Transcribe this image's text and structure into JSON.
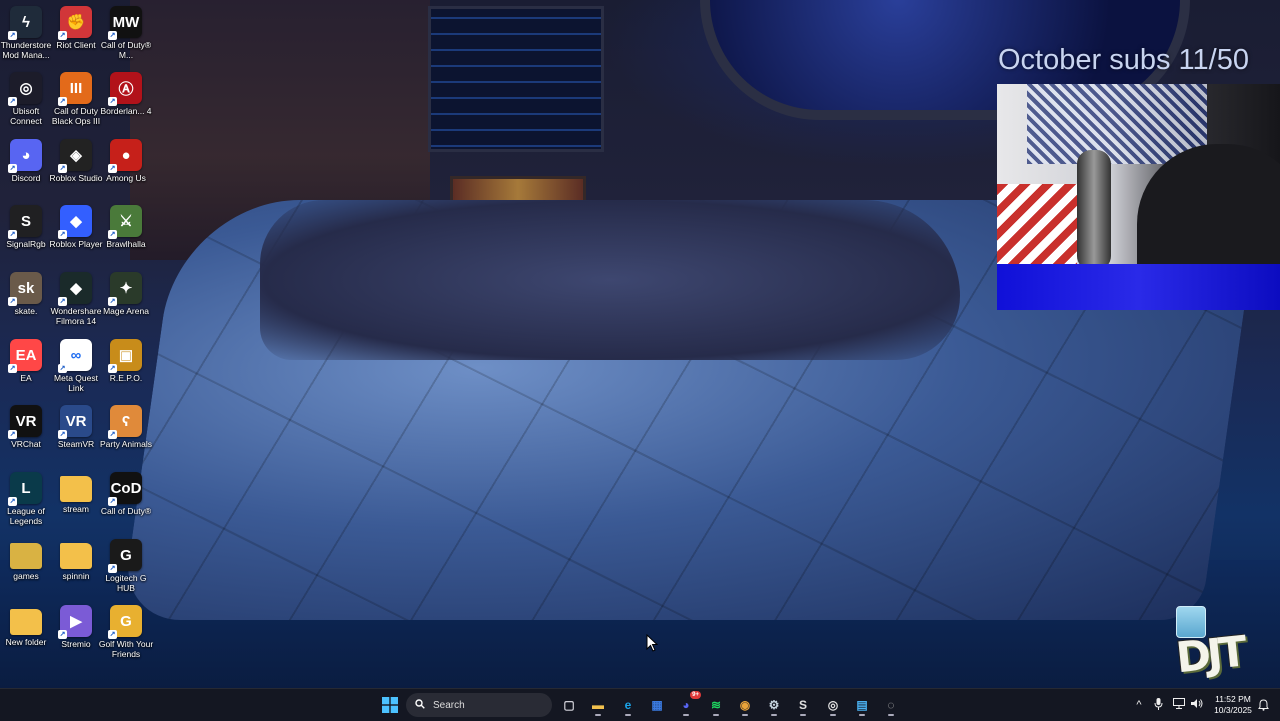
{
  "overlay": {
    "subs_text": "October subs 11/50",
    "corner_logo": "DJT"
  },
  "desktop_icons": [
    {
      "label": "Thunderstore Mod Mana...",
      "icon": "thunderstore-icon",
      "color": "#1f2b3a",
      "glyph": "ϟ"
    },
    {
      "label": "Riot Client",
      "icon": "riot-client-icon",
      "color": "#d13639",
      "glyph": "✊"
    },
    {
      "label": "Call of Duty® M...",
      "icon": "call-of-duty-mw-icon",
      "color": "#111111",
      "glyph": "MW"
    },
    {
      "label": "Ubisoft Connect",
      "icon": "ubisoft-connect-icon",
      "color": "#1c1c2a",
      "glyph": "◎"
    },
    {
      "label": "Call of Duty Black Ops III",
      "icon": "black-ops-3-icon",
      "color": "#e36a1a",
      "glyph": "III"
    },
    {
      "label": "Borderlan... 4",
      "icon": "borderlands-icon",
      "color": "#b2121a",
      "glyph": "Ⓐ"
    },
    {
      "label": "Discord",
      "icon": "discord-icon",
      "color": "#5865f2",
      "glyph": "◕"
    },
    {
      "label": "Roblox Studio",
      "icon": "roblox-studio-icon",
      "color": "#222222",
      "glyph": "◈"
    },
    {
      "label": "Among Us",
      "icon": "among-us-icon",
      "color": "#c6201a",
      "glyph": "●"
    },
    {
      "label": "SignalRgb",
      "icon": "signalrgb-icon",
      "color": "#202022",
      "glyph": "S"
    },
    {
      "label": "Roblox Player",
      "icon": "roblox-player-icon",
      "color": "#335fff",
      "glyph": "◆"
    },
    {
      "label": "Brawlhalla",
      "icon": "brawlhalla-icon",
      "color": "#4a7a3a",
      "glyph": "⚔"
    },
    {
      "label": "skate.",
      "icon": "skate-icon",
      "color": "#6a5a4a",
      "glyph": "sk"
    },
    {
      "label": "Wondershare Filmora 14",
      "icon": "filmora-icon",
      "color": "#1a2a2a",
      "glyph": "◆"
    },
    {
      "label": "Mage Arena",
      "icon": "mage-arena-icon",
      "color": "#2a3a2a",
      "glyph": "✦"
    },
    {
      "label": "EA",
      "icon": "ea-icon",
      "color": "#ff4747",
      "glyph": "EA"
    },
    {
      "label": "Meta Quest Link",
      "icon": "meta-quest-link-icon",
      "color": "#ffffff",
      "glyph": "∞"
    },
    {
      "label": "R.E.P.O.",
      "icon": "repo-icon",
      "color": "#c88c1a",
      "glyph": "▣"
    },
    {
      "label": "VRChat",
      "icon": "vrchat-icon",
      "color": "#111111",
      "glyph": "VR"
    },
    {
      "label": "SteamVR",
      "icon": "steamvr-icon",
      "color": "#2a4a8a",
      "glyph": "VR"
    },
    {
      "label": "Party Animals",
      "icon": "party-animals-icon",
      "color": "#e08a3a",
      "glyph": "ʕ"
    },
    {
      "label": "League of Legends",
      "icon": "league-of-legends-icon",
      "color": "#0a3a4a",
      "glyph": "L"
    },
    {
      "label": "stream",
      "icon": "folder-icon",
      "color": "#f3c04a",
      "glyph": ""
    },
    {
      "label": "Call of Duty®",
      "icon": "call-of-duty-icon",
      "color": "#111111",
      "glyph": "CoD"
    },
    {
      "label": "games",
      "icon": "folder-icon",
      "color": "#d9b243",
      "glyph": ""
    },
    {
      "label": "spinnin",
      "icon": "folder-icon",
      "color": "#f3c04a",
      "glyph": ""
    },
    {
      "label": "Logitech G HUB",
      "icon": "logitech-g-hub-icon",
      "color": "#1a1a1a",
      "glyph": "G"
    },
    {
      "label": "New folder",
      "icon": "folder-icon",
      "color": "#f3c04a",
      "glyph": ""
    },
    {
      "label": "Stremio",
      "icon": "stremio-icon",
      "color": "#7b5bd6",
      "glyph": "▶"
    },
    {
      "label": "Golf With Your Friends",
      "icon": "golf-with-friends-icon",
      "color": "#e8b030",
      "glyph": "G"
    }
  ],
  "taskbar": {
    "search_placeholder": "Search",
    "apps": [
      {
        "name": "task-view",
        "glyph": "▢",
        "color": "#d0d0d8"
      },
      {
        "name": "file-explorer",
        "glyph": "▬",
        "color": "#f2c14e"
      },
      {
        "name": "edge",
        "glyph": "e",
        "color": "#1aa3e8"
      },
      {
        "name": "microsoft-store",
        "glyph": "▦",
        "color": "#3a7ae0"
      },
      {
        "name": "discord",
        "glyph": "◕",
        "color": "#5865f2"
      },
      {
        "name": "spotify",
        "glyph": "≋",
        "color": "#1ed760"
      },
      {
        "name": "chrome",
        "glyph": "◉",
        "color": "#e8a33a"
      },
      {
        "name": "steam",
        "glyph": "⚙",
        "color": "#c6d4df"
      },
      {
        "name": "signalrgb",
        "glyph": "S",
        "color": "#e0e0e0"
      },
      {
        "name": "obs",
        "glyph": "◎",
        "color": "#e0e0e0"
      },
      {
        "name": "notepad",
        "glyph": "▤",
        "color": "#4ab0f0"
      },
      {
        "name": "app",
        "glyph": "◌",
        "color": "#c0c0c0"
      }
    ],
    "discord_badge": "9+",
    "tray_chevron": "^",
    "time": "11:52 PM",
    "date": "10/3/2025"
  }
}
